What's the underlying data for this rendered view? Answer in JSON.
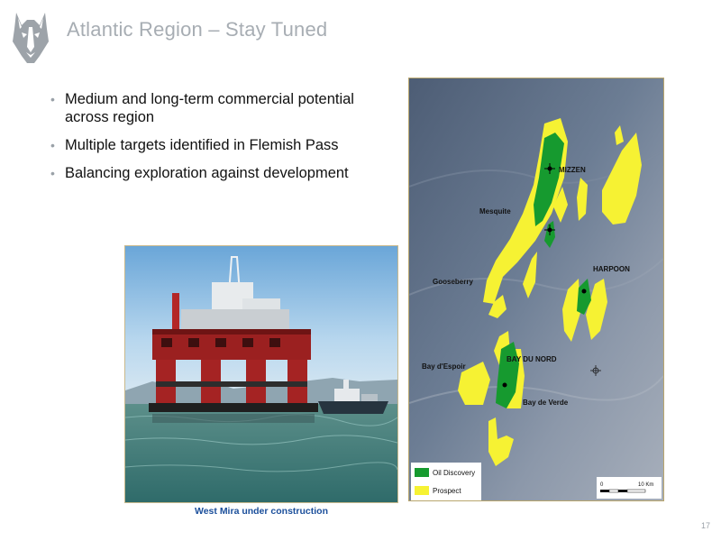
{
  "slide": {
    "title": "Atlantic Region – Stay Tuned",
    "page_number": "17"
  },
  "bullets": [
    "Medium and long-term commercial potential across region",
    "Multiple targets identified in Flemish Pass",
    "Balancing exploration against development"
  ],
  "photo": {
    "caption": "West Mira under construction"
  },
  "map": {
    "labels": {
      "mizzen": "MIZZEN",
      "mesquite": "Mesquite",
      "gooseberry": "Gooseberry",
      "harpoon": "HARPOON",
      "bay_du_nord": "BAY DU NORD",
      "bay_despoir": "Bay d'Espoir",
      "bay_de_verde": "Bay de Verde"
    },
    "legend": {
      "oil_discovery": "Oil Discovery",
      "prospect": "Prospect"
    },
    "scale": {
      "start": "0",
      "end": "10 Km"
    },
    "colors": {
      "oil_discovery": "#169a2f",
      "prospect": "#f6f233",
      "sea": "#5e6f86"
    }
  },
  "logo_icon": "husky-dog-logo-icon"
}
